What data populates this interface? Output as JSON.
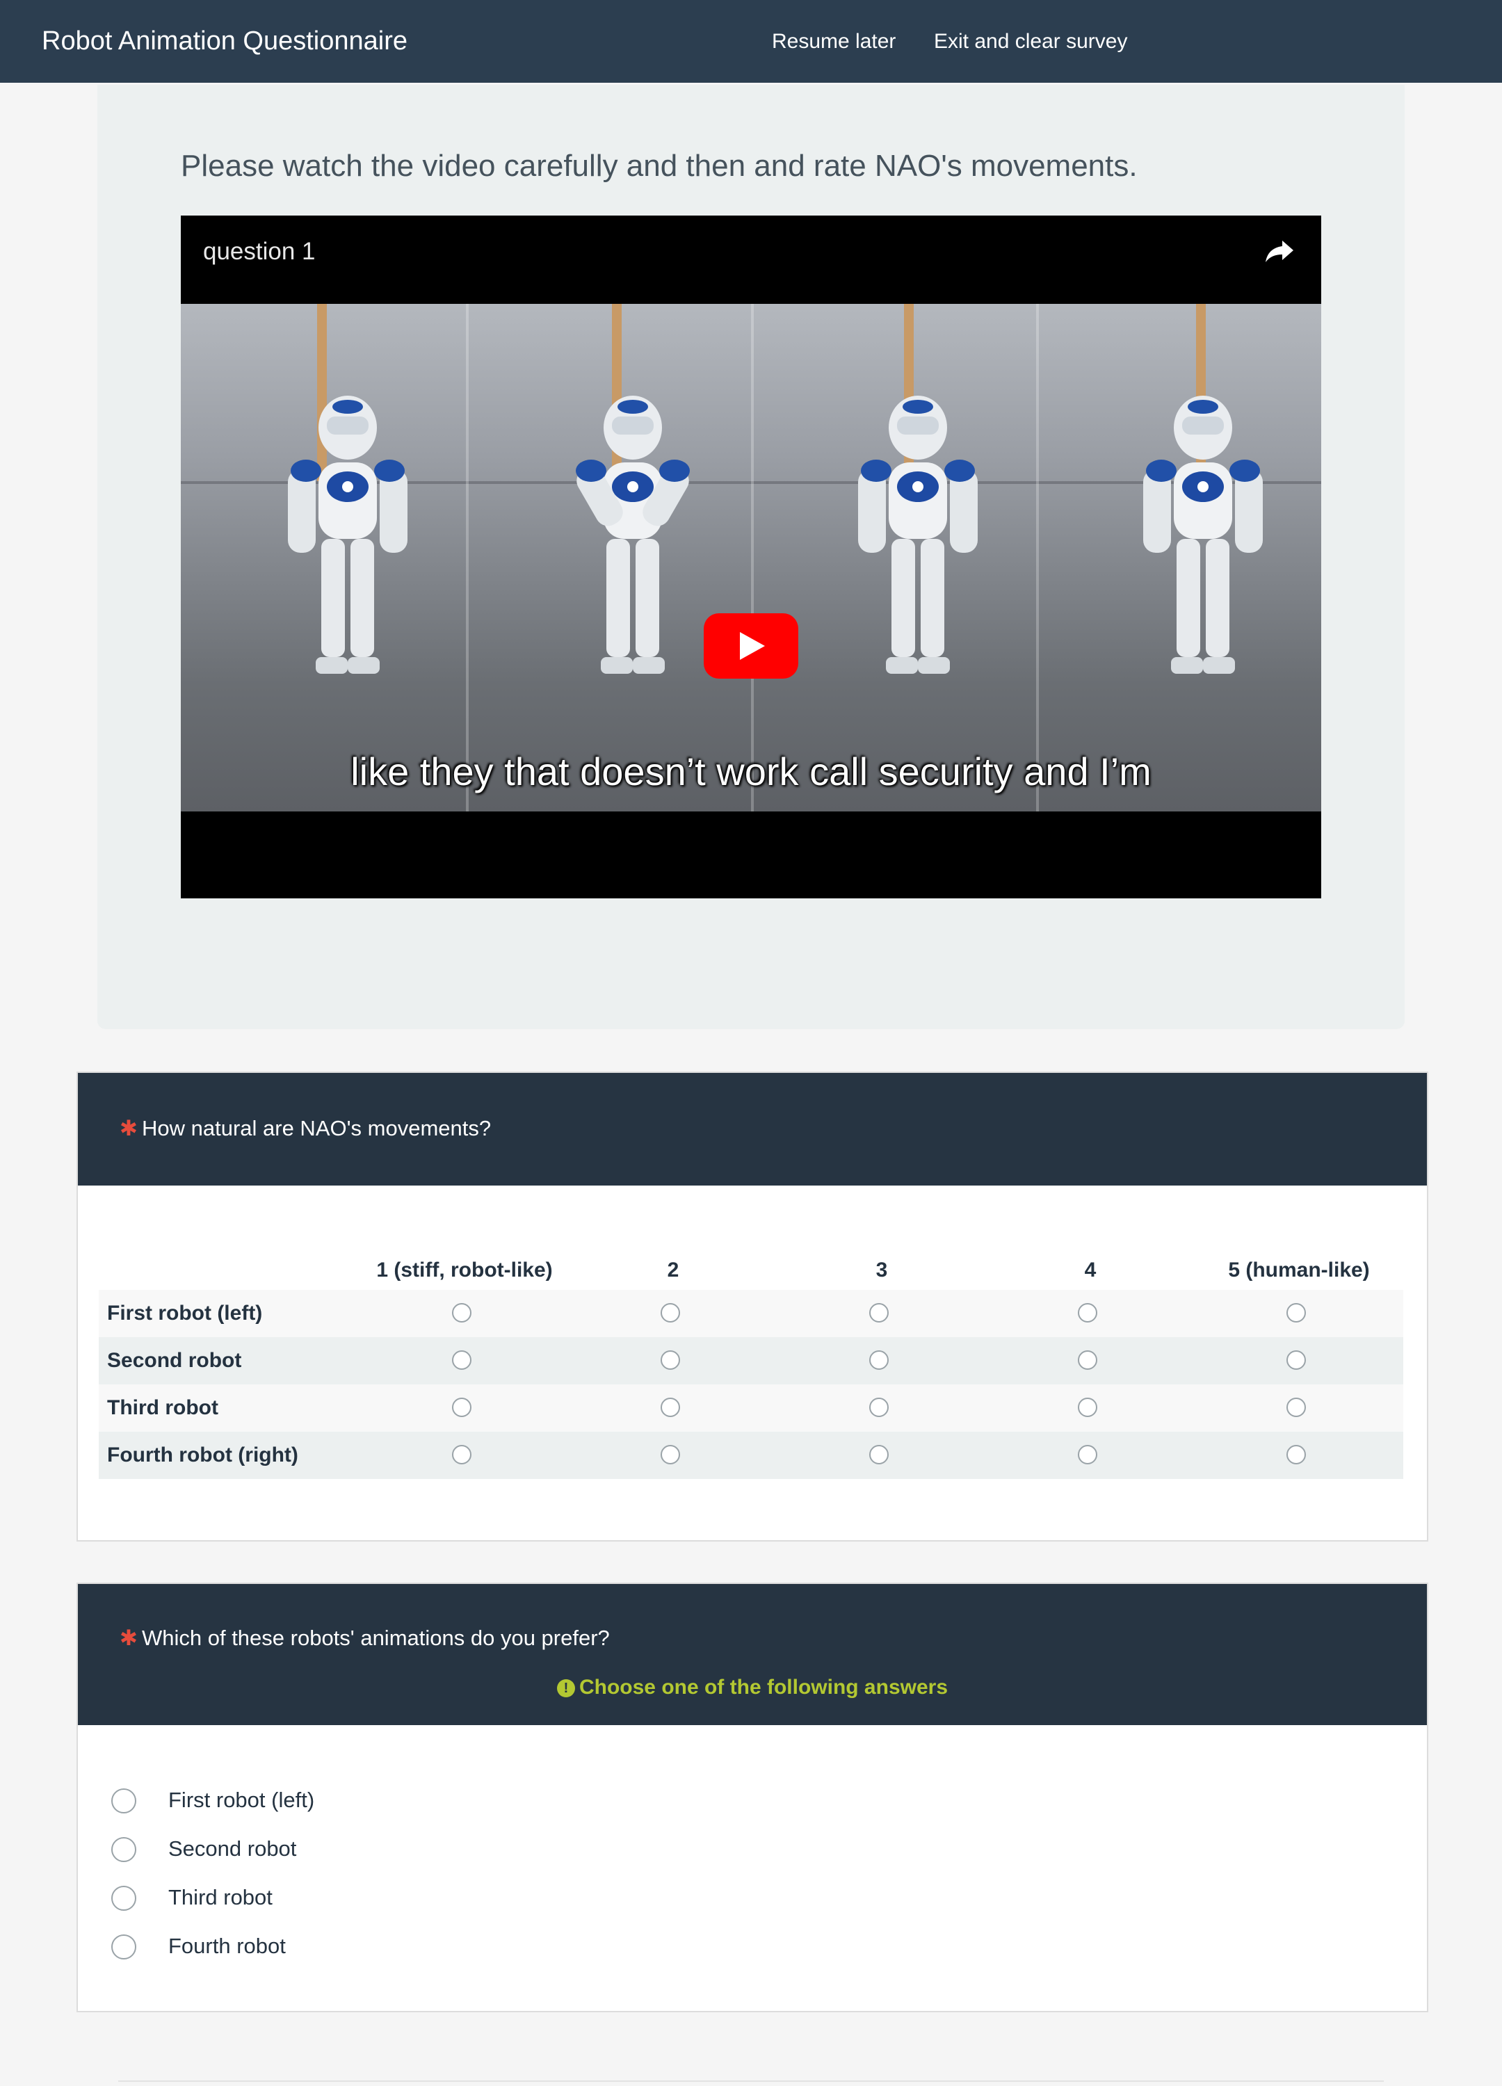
{
  "navbar": {
    "title": "Robot Animation Questionnaire",
    "resume_label": "Resume later",
    "exit_label": "Exit and clear survey"
  },
  "intro": {
    "text": "Please watch the video carefully and then and rate NAO's movements.",
    "video": {
      "title": "question 1",
      "subtitle": "like they that doesn’t work call security and I’m",
      "share_icon": "share-arrow-icon",
      "play_icon": "youtube-play-icon"
    }
  },
  "q1": {
    "required_mark": "✱",
    "text": "How natural are NAO's movements?",
    "columns": [
      "1 (stiff, robot-like)",
      "2",
      "3",
      "4",
      "5 (human-like)"
    ],
    "rows": [
      "First robot (left)",
      "Second robot",
      "Third robot",
      "Fourth robot (right)"
    ]
  },
  "q2": {
    "required_mark": "✱",
    "text": "Which of these robots' animations do you prefer?",
    "tip_icon": "!",
    "tip": "Choose one of the following answers",
    "options": [
      "First robot (left)",
      "Second robot",
      "Third robot",
      "Fourth robot"
    ]
  },
  "colors": {
    "navbar": "#2c3e50",
    "question_header": "#263442",
    "required": "#e74c3c",
    "tip": "#b3c832",
    "youtube_red": "#ff0000"
  }
}
